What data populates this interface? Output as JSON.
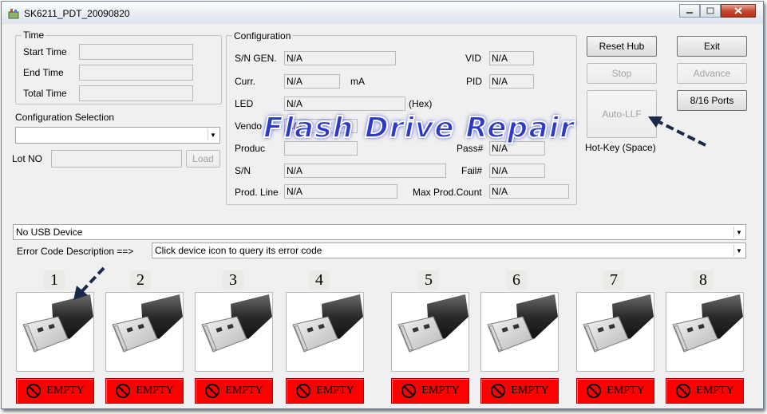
{
  "window": {
    "title": "SK6211_PDT_20090820"
  },
  "time_group": {
    "title": "Time",
    "start_label": "Start Time",
    "start_value": "",
    "end_label": "End Time",
    "end_value": "",
    "total_label": "Total Time",
    "total_value": ""
  },
  "config_selection": {
    "label": "Configuration Selection",
    "value": ""
  },
  "lot": {
    "label": "Lot NO",
    "value": "",
    "load_label": "Load"
  },
  "configuration": {
    "title": "Configuration",
    "sn_gen_label": "S/N GEN.",
    "sn_gen_value": "N/A",
    "vid_label": "VID",
    "vid_value": "N/A",
    "curr_label": "Curr.",
    "curr_value": "N/A",
    "curr_unit": "mA",
    "pid_label": "PID",
    "pid_value": "N/A",
    "led_label": "LED",
    "led_value": "N/A",
    "led_unit": "(Hex)",
    "vendor_label": "Vendo",
    "vendor_value": "N/A",
    "product_label": "Produc",
    "pass_label": "Pass#",
    "pass_value": "N/A",
    "sn_label": "S/N",
    "sn_value": "N/A",
    "fail_label": "Fail#",
    "fail_value": "N/A",
    "prodline_label": "Prod. Line",
    "prodline_value": "N/A",
    "maxprod_label": "Max Prod.Count",
    "maxprod_value": "N/A"
  },
  "buttons": {
    "reset_hub": "Reset Hub",
    "exit": "Exit",
    "stop": "Stop",
    "advance": "Advance",
    "ports": "8/16 Ports",
    "auto_llf": "Auto-LLF",
    "hotkey": "Hot-Key (Space)"
  },
  "usb_device": {
    "value": "No USB Device"
  },
  "error_code": {
    "label": "Error Code Description ==>",
    "value": "Click device icon to query its error code"
  },
  "ports": [
    {
      "number": "1",
      "status": "EMPTY"
    },
    {
      "number": "2",
      "status": "EMPTY"
    },
    {
      "number": "3",
      "status": "EMPTY"
    },
    {
      "number": "4",
      "status": "EMPTY"
    },
    {
      "number": "5",
      "status": "EMPTY"
    },
    {
      "number": "6",
      "status": "EMPTY"
    },
    {
      "number": "7",
      "status": "EMPTY"
    },
    {
      "number": "8",
      "status": "EMPTY"
    }
  ],
  "overlay": {
    "text": "Flash Drive Repair"
  },
  "colors": {
    "status_empty": "#ff0000",
    "overlay_text": "#2d39c8",
    "arrow": "#1b2a4a"
  },
  "icons": {
    "port_image": "usb-flash-drive-icon",
    "status_icon": "no-entry-icon"
  }
}
